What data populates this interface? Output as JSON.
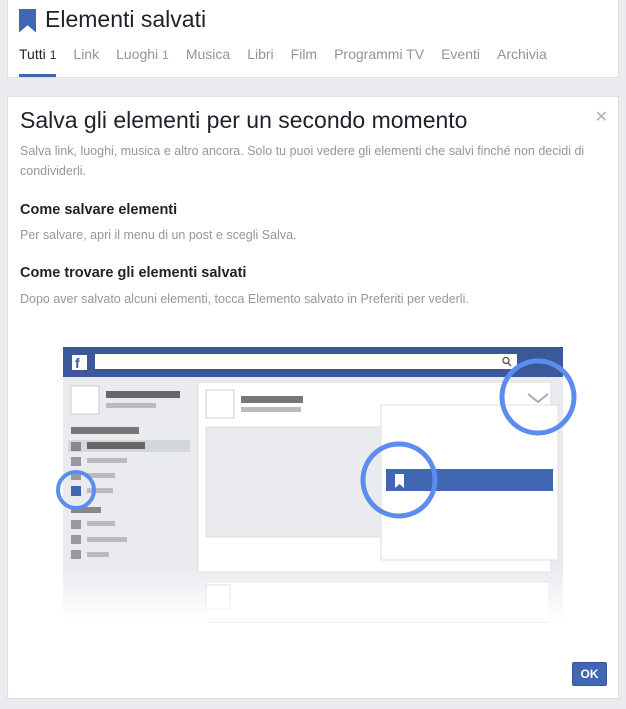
{
  "header": {
    "title": "Elementi salvati",
    "tabs": [
      {
        "label": "Tutti",
        "count": "1",
        "active": true
      },
      {
        "label": "Link",
        "count": ""
      },
      {
        "label": "Luoghi",
        "count": "1"
      },
      {
        "label": "Musica",
        "count": ""
      },
      {
        "label": "Libri",
        "count": ""
      },
      {
        "label": "Film",
        "count": ""
      },
      {
        "label": "Programmi TV",
        "count": ""
      },
      {
        "label": "Eventi",
        "count": ""
      },
      {
        "label": "Archivia",
        "count": ""
      }
    ]
  },
  "card": {
    "title": "Salva gli elementi per un secondo momento",
    "intro": "Salva link, luoghi, musica e altro ancora. Solo tu puoi vedere gli elementi che salvi finché non decidi di condividerli.",
    "section1_title": "Come salvare elementi",
    "section1_text": "Per salvare, apri il menu di un post e scegli Salva.",
    "section2_title": "Come trovare gli elementi salvati",
    "section2_text": "Dopo aver salvato alcuni elementi, tocca Elemento salvato in Preferiti per vederli.",
    "ok_label": "OK",
    "close_icon": "close-icon"
  },
  "colors": {
    "brand": "#4267b2",
    "highlight": "#5b8def",
    "muted_text": "#90949c",
    "background": "#e9ebee"
  }
}
